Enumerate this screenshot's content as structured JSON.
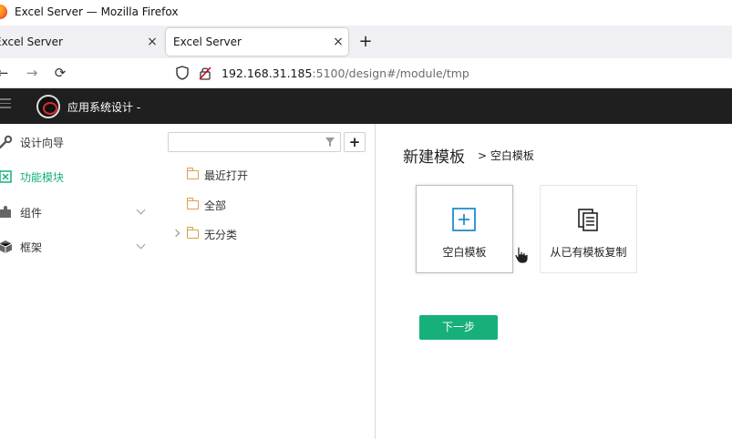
{
  "window": {
    "title": "Excel Server — Mozilla Firefox"
  },
  "tabs": [
    {
      "label": "Excel Server",
      "close": "×"
    },
    {
      "label": "Excel Server",
      "close": "×"
    }
  ],
  "new_tab": "+",
  "navbar": {
    "back": "←",
    "forward": "→",
    "reload": "⟳",
    "url_host": "192.168.31.185",
    "url_path": ":5100/design#/module/tmp"
  },
  "app": {
    "title": "应用系统设计 -"
  },
  "leftnav": {
    "items": [
      {
        "label": "设计向导",
        "icon": "wrench-icon"
      },
      {
        "label": "功能模块",
        "icon": "module-icon",
        "active": true
      },
      {
        "label": "组件",
        "icon": "puzzle-icon"
      },
      {
        "label": "框架",
        "icon": "box-icon"
      }
    ]
  },
  "tree": {
    "search_value": "",
    "add_label": "+",
    "items": [
      {
        "label": "最近打开"
      },
      {
        "label": "全部"
      },
      {
        "label": "无分类"
      }
    ]
  },
  "main": {
    "heading": "新建模板",
    "breadcrumb": "> 空白模板",
    "cards": [
      {
        "label": "空白模板",
        "icon": "plus-square-icon"
      },
      {
        "label": "从已有模板复制",
        "icon": "copy-document-icon"
      }
    ],
    "next_button": "下一步"
  },
  "colors": {
    "accent": "#17b07a",
    "appbar": "#1f1f1f",
    "folder": "#d9a24b"
  }
}
